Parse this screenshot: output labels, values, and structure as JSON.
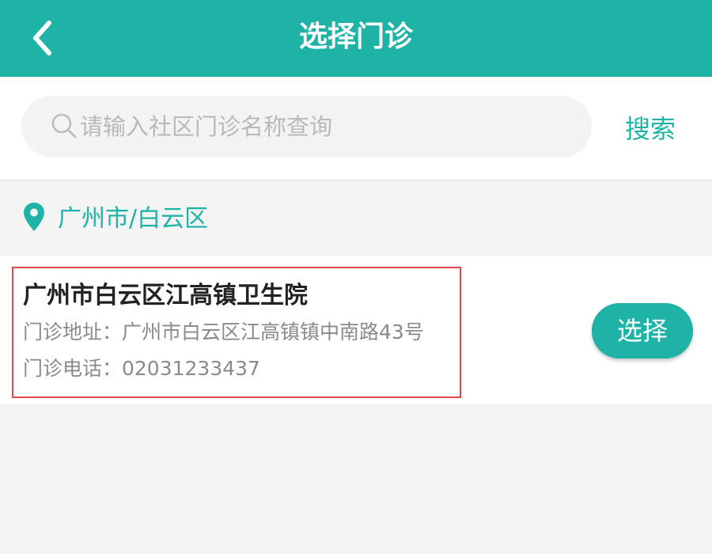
{
  "header": {
    "title": "选择门诊",
    "back_icon": "chevron-left-icon"
  },
  "search": {
    "placeholder": "请输入社区门诊名称查询",
    "value": "",
    "button_label": "搜索",
    "icon": "search-icon"
  },
  "location": {
    "icon": "map-pin-icon",
    "text": "广州市/白云区"
  },
  "clinics": [
    {
      "name": "广州市白云区江高镇卫生院",
      "address": "门诊地址：广州市白云区江高镇镇中南路43号",
      "phone": "门诊电话：02031233437",
      "select_label": "选择"
    }
  ],
  "colors": {
    "primary": "#1eb3a6",
    "highlight_border": "#e0474c",
    "background": "#f4f4f4"
  }
}
